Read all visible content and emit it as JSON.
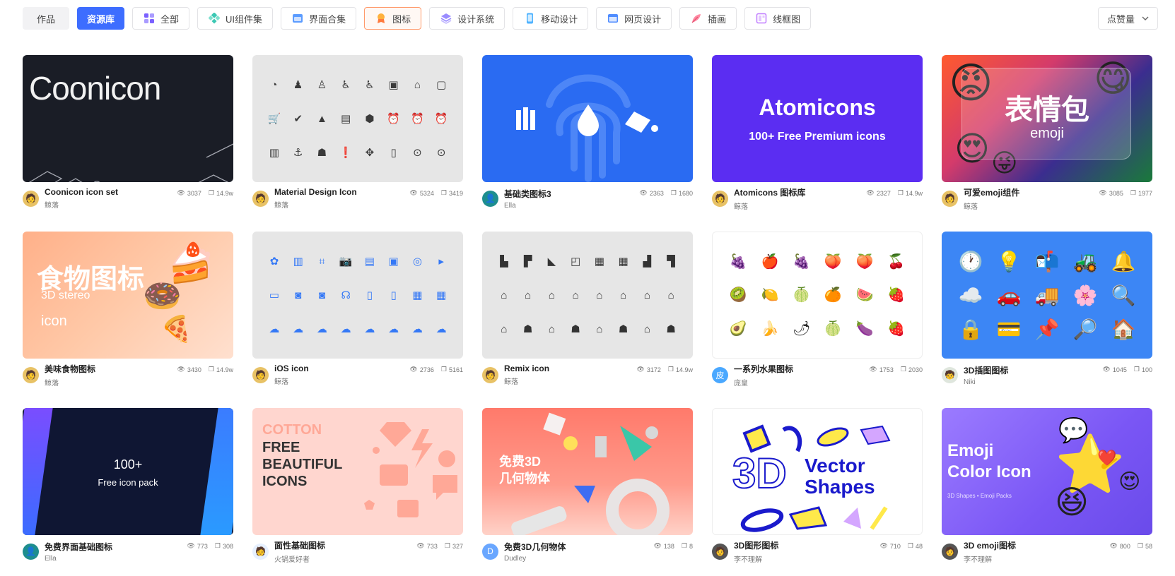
{
  "filters": {
    "works": "作品",
    "library": "资源库",
    "tags": [
      {
        "label": "全部",
        "icon": "grid-icon",
        "color": "#7b61ff"
      },
      {
        "label": "UI组件集",
        "icon": "component-icon",
        "color": "#3cc8b4"
      },
      {
        "label": "界面合集",
        "icon": "layers-window-icon",
        "color": "#5b9cff"
      },
      {
        "label": "图标",
        "icon": "badge-icon",
        "color": "#ff8a3d"
      },
      {
        "label": "设计系统",
        "icon": "stack-icon",
        "color": "#9a8cff"
      },
      {
        "label": "移动设计",
        "icon": "phone-icon",
        "color": "#4fb3ff"
      },
      {
        "label": "网页设计",
        "icon": "browser-icon",
        "color": "#4f8cff"
      },
      {
        "label": "插画",
        "icon": "feather-icon",
        "color": "#ff6b8a"
      },
      {
        "label": "线框图",
        "icon": "wireframe-icon",
        "color": "#c07cff"
      }
    ],
    "sort": "点赞量"
  },
  "cards": [
    {
      "title": "Coonicon icon set",
      "author": "鲸落",
      "views": "3037",
      "likes": "14.9w",
      "thumb_text": "Coonicon"
    },
    {
      "title": "Material Design Icon",
      "author": "鲸落",
      "views": "5324",
      "likes": "3419"
    },
    {
      "title": "基础类图标3",
      "author": "Ella",
      "views": "2363",
      "likes": "1680"
    },
    {
      "title": "Atomicons 图标库",
      "author": "鲸落",
      "views": "2327",
      "likes": "14.9w",
      "thumb_text": "Atomicons",
      "thumb_sub": "100+ Free Premium icons"
    },
    {
      "title": "可爱emoji组件",
      "author": "鲸落",
      "views": "3085",
      "likes": "1977",
      "thumb_text": "表情包",
      "thumb_sub": "emoji"
    },
    {
      "title": "美味食物图标",
      "author": "鲸落",
      "views": "3430",
      "likes": "14.9w",
      "thumb_text": "食物图标",
      "thumb_sub": "3D stereo",
      "thumb_sub2": "icon"
    },
    {
      "title": "iOS icon",
      "author": "鲸落",
      "views": "2736",
      "likes": "5161"
    },
    {
      "title": "Remix icon",
      "author": "鲸落",
      "views": "3172",
      "likes": "14.9w"
    },
    {
      "title": "一系列水果图标",
      "author": "庞皇",
      "views": "1753",
      "likes": "2030",
      "avatar_text": "皮"
    },
    {
      "title": "3D插图图标",
      "author": "Niki",
      "views": "1045",
      "likes": "100"
    },
    {
      "title": "免费界面基础图标",
      "author": "Ella",
      "views": "773",
      "likes": "308",
      "thumb_text": "100+",
      "thumb_sub": "Free icon pack"
    },
    {
      "title": "面性基础图标",
      "author": "火锅爱好者",
      "views": "733",
      "likes": "327",
      "thumb_text": "COTTON",
      "thumb_sub": "FREE",
      "thumb_sub2": "BEAUTIFUL",
      "thumb_sub3": "ICONS"
    },
    {
      "title": "免费3D几何物体",
      "author": "Dudley",
      "views": "138",
      "likes": "8",
      "thumb_text": "免费3D",
      "thumb_sub": "几何物体",
      "avatar_text": "D"
    },
    {
      "title": "3D图形图标",
      "author": "李不理解",
      "views": "710",
      "likes": "48",
      "thumb_text": "3D",
      "thumb_sub": "Vector",
      "thumb_sub2": "Shapes"
    },
    {
      "title": "3D emoji图标",
      "author": "李不理解",
      "views": "800",
      "likes": "58",
      "thumb_text": "Emoji",
      "thumb_sub": "Color Icon",
      "thumb_sub2": "3D Shapes  •  Emoji Packs"
    }
  ]
}
